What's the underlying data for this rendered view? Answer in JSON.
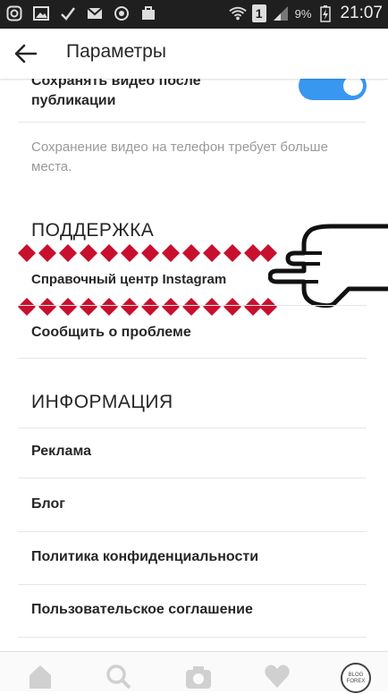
{
  "status_bar": {
    "battery_percent": "9%",
    "time": "21:07",
    "sim_label": "1"
  },
  "header": {
    "title": "Параметры"
  },
  "settings": {
    "save_video_label": "Сохранять видео после публикации",
    "save_video_enabled": true,
    "save_video_hint": "Сохранение видео на телефон требует больше места.",
    "support_header": "ПОДДЕРЖКА",
    "support_items": [
      "Справочный центр Instagram",
      "Сообщить о проблеме"
    ],
    "info_header": "ИНФОРМАЦИЯ",
    "info_items": [
      "Реклама",
      "Блог",
      "Политика конфиденциальности",
      "Пользовательское соглашение"
    ]
  },
  "bottom_nav": {
    "items": [
      "home-icon",
      "search-icon",
      "camera-icon",
      "heart-icon",
      "profile-avatar"
    ],
    "watermark": [
      "BLOG",
      "FOREX"
    ]
  },
  "colors": {
    "toggle_on": "#3897f0",
    "annotation": "#c8102e",
    "status_bar": "#1f1f1f"
  }
}
